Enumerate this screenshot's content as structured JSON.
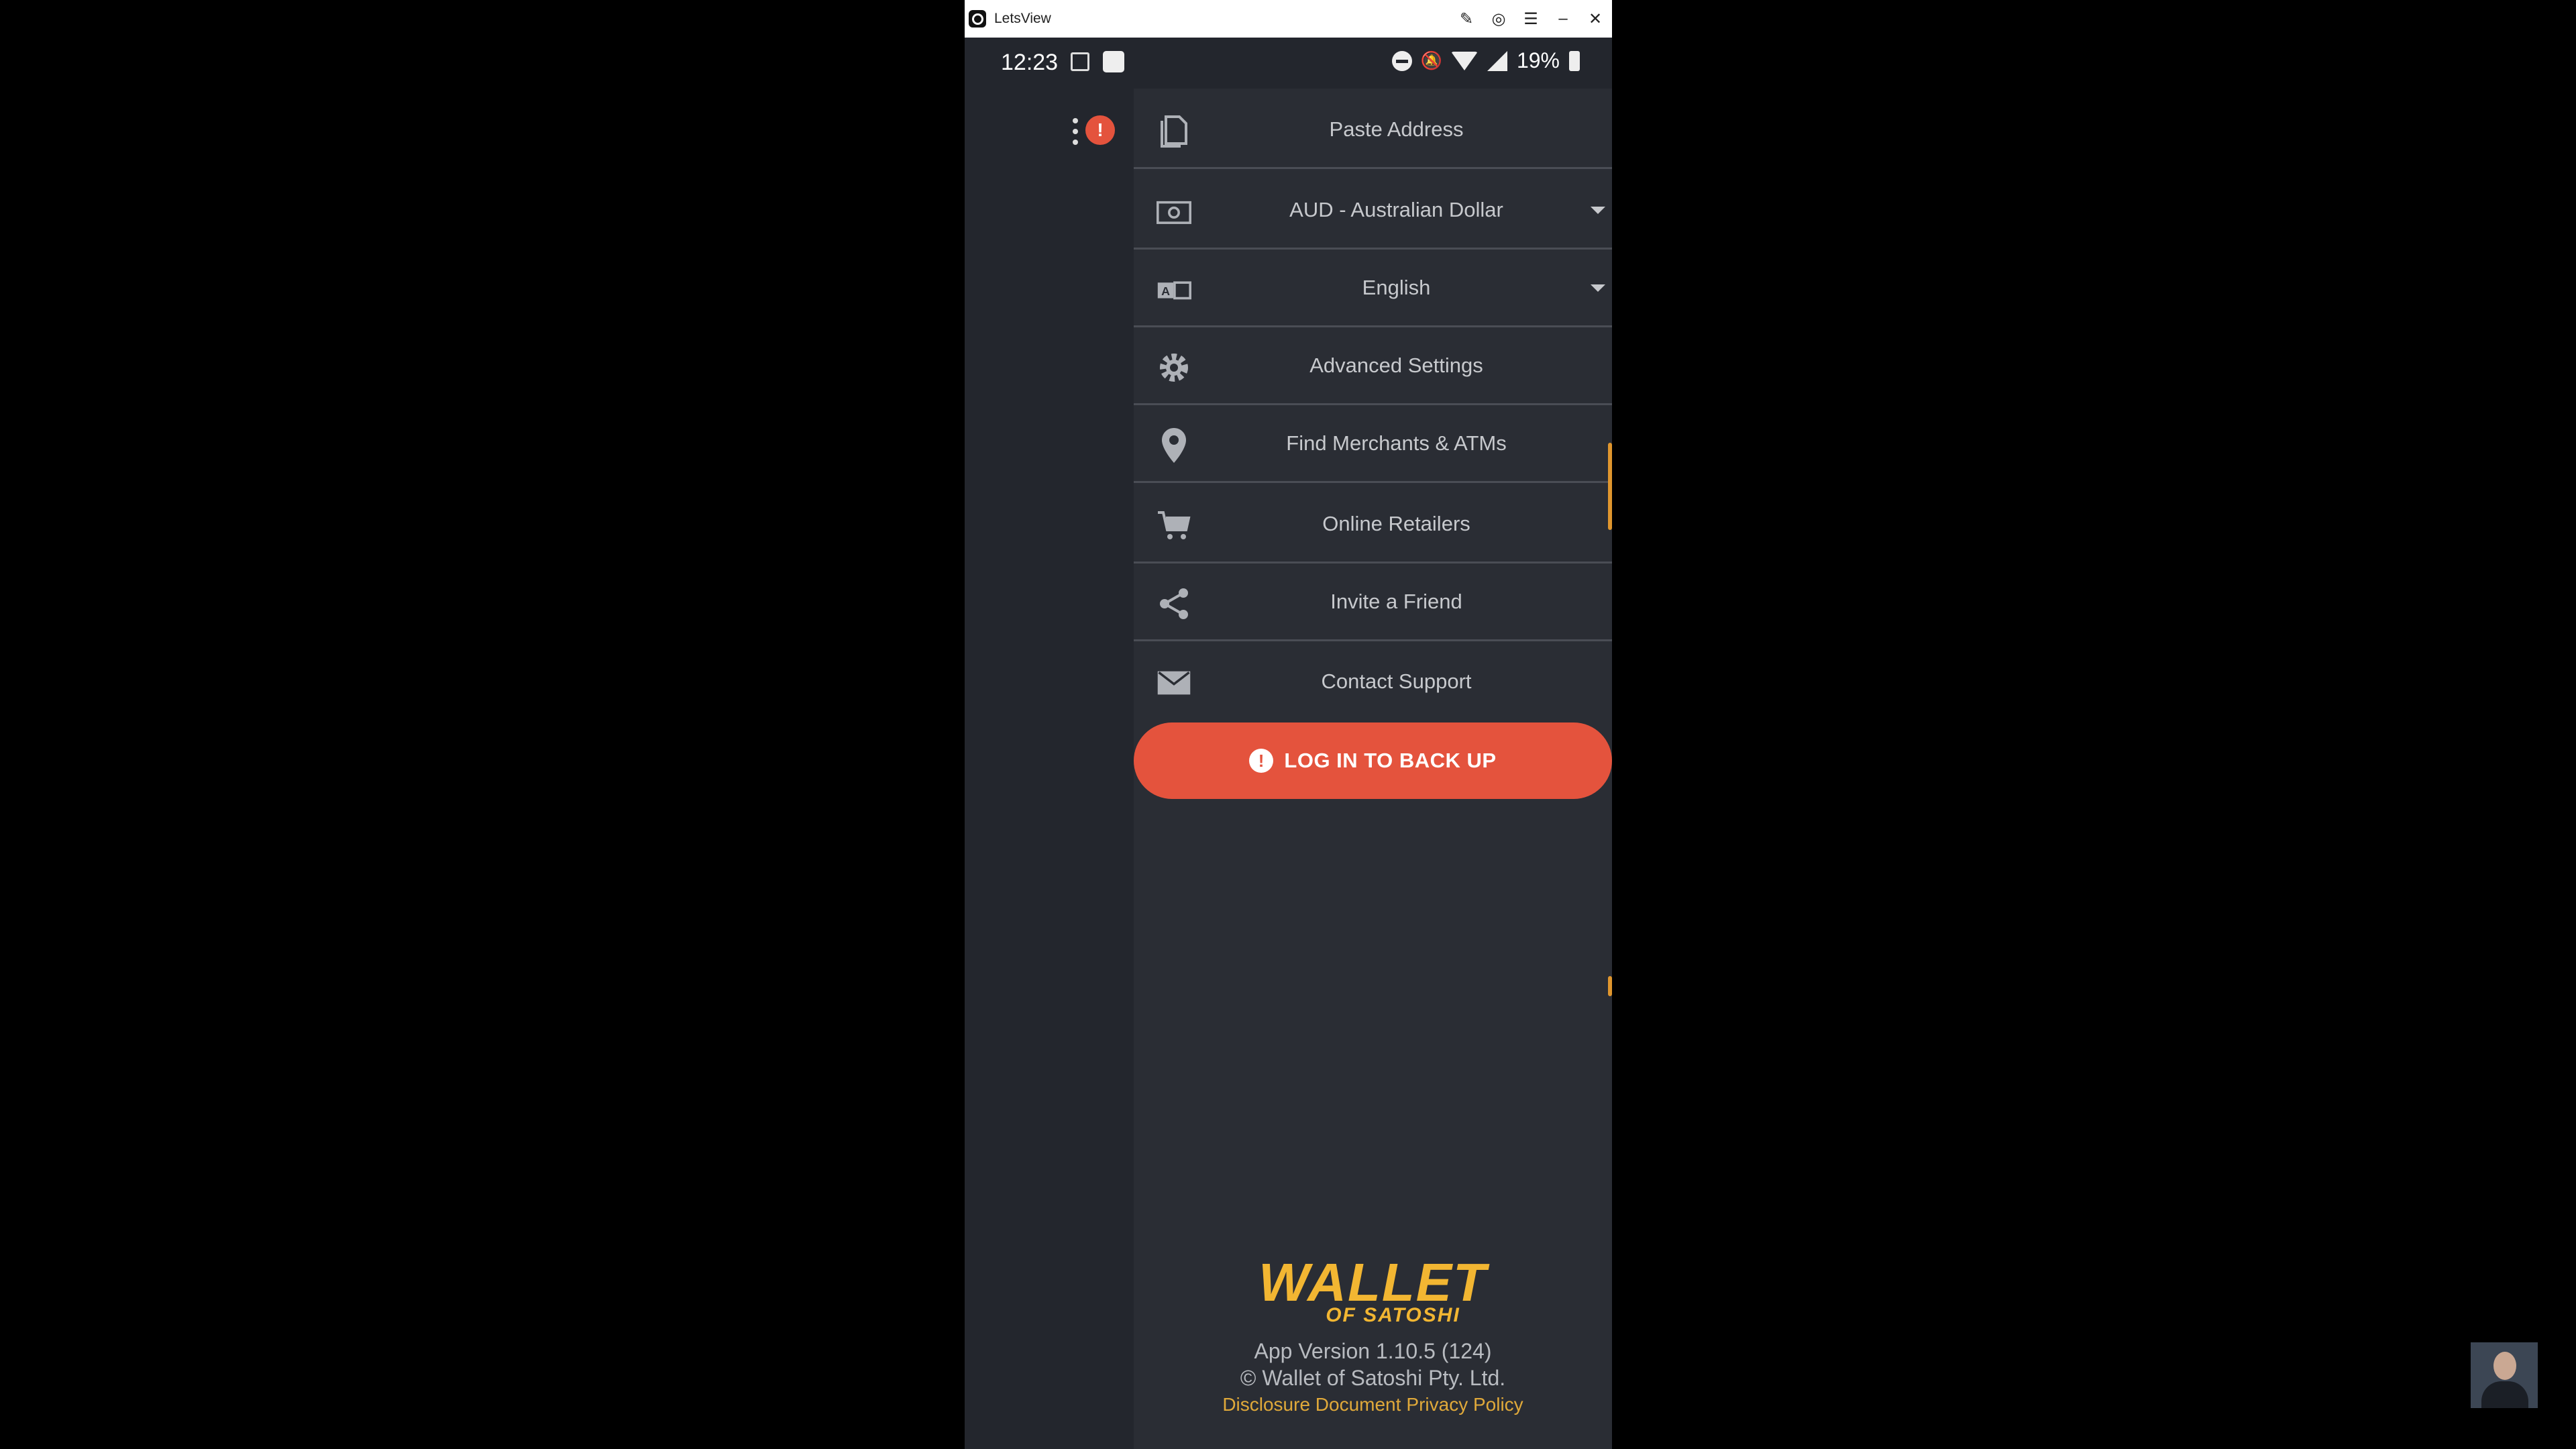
{
  "window": {
    "title": "LetsView"
  },
  "status_bar": {
    "time": "12:23",
    "battery": "19%"
  },
  "drawer": {
    "items": [
      {
        "label": "Paste Address",
        "icon": "document-copy-icon"
      },
      {
        "label": "AUD - Australian Dollar",
        "icon": "money-icon",
        "dropdown": true
      },
      {
        "label": "English",
        "icon": "translate-icon",
        "dropdown": true
      },
      {
        "label": "Advanced Settings",
        "icon": "gear-icon"
      },
      {
        "label": "Find Merchants & ATMs",
        "icon": "map-pin-icon"
      },
      {
        "label": "Online Retailers",
        "icon": "shopping-cart-icon"
      },
      {
        "label": "Invite a Friend",
        "icon": "share-icon"
      },
      {
        "label": "Contact Support",
        "icon": "mail-icon"
      }
    ],
    "login_button": "LOG IN TO BACK UP"
  },
  "footer": {
    "brand_main": "WALLET",
    "brand_sub": "OF SATOSHI",
    "version": "App Version 1.10.5 (124)",
    "copyright": "© Wallet of Satoshi Pty. Ltd.",
    "links": [
      "Disclosure Document",
      "Privacy Policy"
    ]
  },
  "colors": {
    "accent": "#e4533d",
    "brand": "#f2b632",
    "drawer_bg": "#2a2d34"
  }
}
